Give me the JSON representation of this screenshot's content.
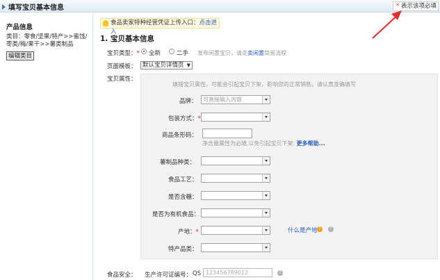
{
  "header": {
    "title": "填写宝贝基本信息",
    "required_note_star": "*",
    "required_note": "表示该项必填"
  },
  "sidebar": {
    "title": "产品信息",
    "category": "类目：零食/坚果/特产>>蜜饯/枣类/梅/果干>>薯类制品",
    "edit_button": "编辑类目"
  },
  "notice": {
    "text": "食品卖家特种经营凭证上传入口：",
    "link": "点击进入"
  },
  "section_title": "1. 宝贝基本信息",
  "item_type": {
    "label": "宝贝类型：",
    "options": [
      "全新",
      "二手"
    ],
    "selected": "全新",
    "hint_prefix": "发布闲置宝贝，请走",
    "hint_link": "卖闲置",
    "hint_suffix": "简易流程"
  },
  "page_template": {
    "label": "页面模板：",
    "value": "默认宝贝详情页"
  },
  "attributes": {
    "label": "宝贝属性：",
    "hint": "填错宝贝属性，可能会引起宝贝下架，影响您的正常销售。请认真准确填写",
    "brand": {
      "label": "品牌：",
      "placeholder": "可直接输入内容"
    },
    "packaging": {
      "label": "包装方式："
    },
    "barcode": {
      "label": "商品条形码：",
      "hint": "净含量属性为必填,以免引起宝贝下架.",
      "hint_link": "更多帮助..."
    },
    "potato_type": {
      "label": "薯制品种类："
    },
    "process": {
      "label": "食品工艺："
    },
    "sugar": {
      "label": "是否含糖："
    },
    "organic": {
      "label": "是否为有机食品："
    },
    "origin": {
      "label": "产地：",
      "help_link": "什么是产地"
    },
    "specialty": {
      "label": "特产品类："
    }
  },
  "food_safety": {
    "label": "食品安全：",
    "license_label": "生产许可证编号：",
    "license_prefix": "QS",
    "license_placeholder": "123456789012"
  }
}
